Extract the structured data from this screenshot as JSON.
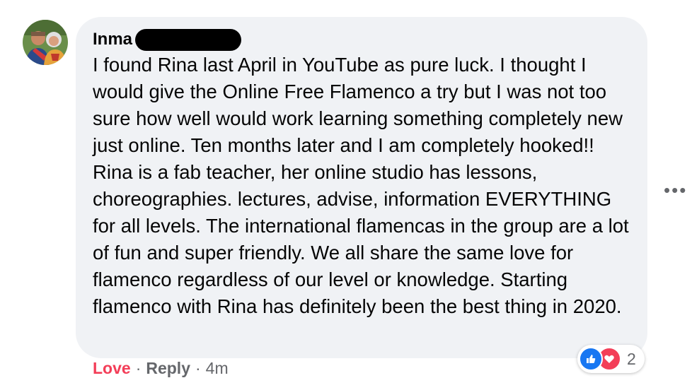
{
  "comment": {
    "author_name": "Inma",
    "text": "I found Rina last April in YouTube as pure luck. I thought I would give the Online Free Flamenco a try but I was not too sure how well would work learning something completely new just online. Ten months later and I am completely hooked!! Rina is a fab teacher, her online studio has lessons, choreographies. lectures, advise, information EVERYTHING for all levels. The international flamencas in the group are a lot of fun and super friendly. We all share the same love for flamenco regardless of our level or knowledge. Starting flamenco with Rina has definitely been the best thing in 2020.",
    "more_options_glyph": "•••"
  },
  "actions": {
    "love_label": "Love",
    "separator": "·",
    "reply_label": "Reply",
    "timestamp": "4m"
  },
  "reactions": {
    "types": [
      "like-icon",
      "heart-icon"
    ],
    "count": "2"
  },
  "colors": {
    "bubble_bg": "#f0f2f5",
    "love_red": "#f33e58",
    "like_blue": "#1877f2",
    "meta_gray": "#65676b"
  }
}
